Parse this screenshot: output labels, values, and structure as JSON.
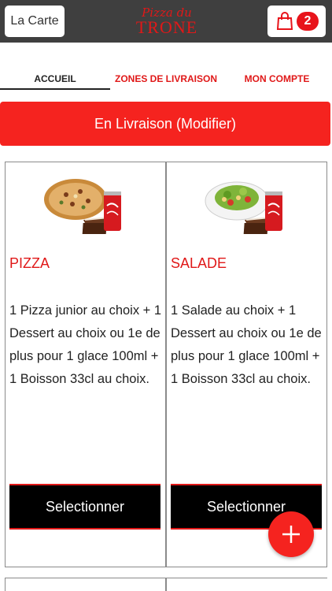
{
  "header": {
    "menu_button_label": "La Carte",
    "logo_script": "Pizza du",
    "logo_main": "TRONE",
    "cart_count": "2"
  },
  "tabs": [
    {
      "label": "ACCUEIL",
      "active": true
    },
    {
      "label": "ZONES DE LIVRAISON",
      "active": false
    },
    {
      "label": "MON COMPTE",
      "active": false
    }
  ],
  "delivery_mode_label": "En Livraison (Modifier)",
  "products": [
    {
      "title": "PIZZA",
      "description": "1 Pizza junior au choix + 1 Dessert au choix ou 1e de plus pour 1 glace 100ml + 1 Boisson 33cl au choix.",
      "button_label": "Selectionner",
      "image": "pizza-menu-image"
    },
    {
      "title": "SALADE",
      "description": "1 Salade au choix + 1 Dessert au choix ou 1e de plus pour 1 glace 100ml + 1 Boisson 33cl au choix.",
      "button_label": "Selectionner",
      "image": "salad-menu-image"
    }
  ],
  "colors": {
    "brand_red": "#f5231f",
    "header_bg": "#3f3f3f",
    "badge_red": "#e8141b"
  },
  "icons": {
    "cart": "shopping-bag-icon",
    "fab": "plus-icon"
  }
}
